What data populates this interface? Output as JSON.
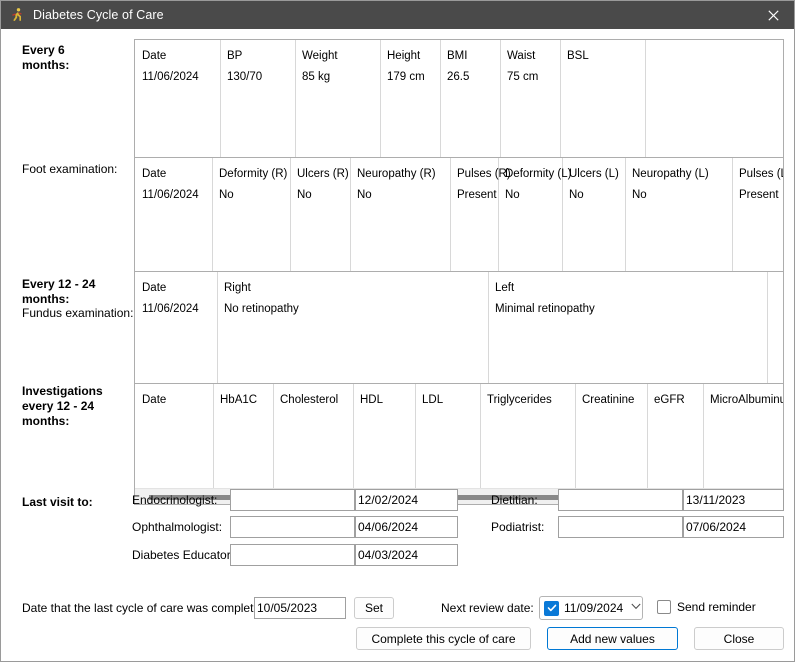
{
  "window": {
    "title": "Diabetes Cycle of Care",
    "icon": "runner-icon",
    "close_label": "✕",
    "titlebar_color": "#4a4a4a",
    "accent_color": "#0078d4"
  },
  "sections": {
    "every6": {
      "label_line1": "Every 6",
      "label_line2": "months:"
    },
    "foot": {
      "label": "Foot examination:"
    },
    "every12": {
      "label_line1": "Every 12 - 24",
      "label_line2": "months:",
      "sub_label": "Fundus examination:"
    },
    "investigations": {
      "label_line1": "Investigations",
      "label_line2": "every 12 - 24",
      "label_line3": "months:"
    },
    "last_visit": {
      "label": "Last visit to:"
    }
  },
  "grid_every6": {
    "columns": [
      "Date",
      "BP",
      "Weight",
      "Height",
      "BMI",
      "Waist",
      "BSL"
    ],
    "rows": [
      [
        "11/06/2024",
        "130/70",
        "85 kg",
        "179 cm",
        "26.5",
        "75 cm",
        ""
      ]
    ]
  },
  "grid_foot": {
    "columns": [
      "Date",
      "Deformity (R)",
      "Ulcers (R)",
      "Neuropathy (R)",
      "Pulses (R)",
      "Deformity (L)",
      "Ulcers (L)",
      "Neuropathy (L)",
      "Pulses (L)"
    ],
    "rows": [
      [
        "11/06/2024",
        "No",
        "No",
        "No",
        "Present",
        "No",
        "No",
        "No",
        "Present"
      ]
    ]
  },
  "grid_fundus": {
    "columns": [
      "Date",
      "Right",
      "Left"
    ],
    "rows": [
      [
        "11/06/2024",
        "No retinopathy",
        "Minimal retinopathy"
      ]
    ]
  },
  "grid_investigations": {
    "columns": [
      "Date",
      "HbA1C",
      "Cholesterol",
      "HDL",
      "LDL",
      "Triglycerides",
      "Creatinine",
      "eGFR",
      "MicroAlbuminu"
    ],
    "rows": [],
    "scrollbar": "horizontal-scrollbar"
  },
  "last_visit_fields": [
    {
      "label": "Endocrinologist:",
      "name_value": "",
      "date_value": "12/02/2024"
    },
    {
      "label": "Ophthalmologist:",
      "name_value": "",
      "date_value": "04/06/2024"
    },
    {
      "label": "Diabetes Educator:",
      "name_value": "",
      "date_value": "04/03/2024"
    },
    {
      "label": "Dietitian:",
      "name_value": "",
      "date_value": "13/11/2023"
    },
    {
      "label": "Podiatrist:",
      "name_value": "",
      "date_value": "07/06/2024"
    }
  ],
  "footer": {
    "completed_label": "Date that the last cycle of care was completed:",
    "completed_date": "10/05/2023",
    "set_button": "Set",
    "next_review_label": "Next review date:",
    "next_review_date": "11/09/2024",
    "next_review_checked": true,
    "next_review_chevron": "⌄",
    "send_reminder_label": "Send reminder",
    "send_reminder_checked": false,
    "complete_button": "Complete this cycle of care",
    "add_values_button": "Add new values",
    "close_button": "Close"
  }
}
